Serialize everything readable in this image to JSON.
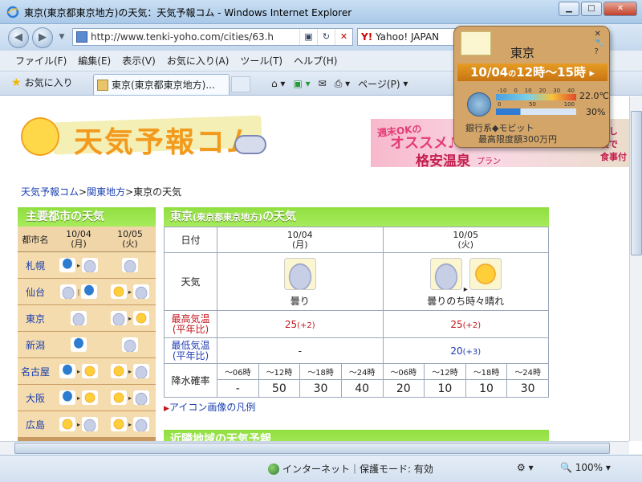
{
  "window": {
    "title": "東京(東京都東京地方)の天気：天気予報コム - Windows Internet Explorer"
  },
  "address": {
    "url": "http://www.tenki-yoho.com/cities/63.h",
    "search_label": "Yahoo! JAPAN"
  },
  "menu": [
    "ファイル(F)",
    "編集(E)",
    "表示(V)",
    "お気に入り(A)",
    "ツール(T)",
    "ヘルプ(H)"
  ],
  "tabbar": {
    "favorites_label": "お気に入り",
    "tab_title": "東京(東京都東京地方)...",
    "page_label": "ページ(P)"
  },
  "site": {
    "logo": "天気予報コム",
    "breadcrumb": [
      "天気予報コム",
      "関東地方",
      "東京の天気"
    ],
    "ad": {
      "line1": "週末OKの",
      "line2": "オススメ♪",
      "line3": "格安温泉",
      "line4": "プラン",
      "side1": "とし",
      "side2": "寝で",
      "side3": "食事付"
    }
  },
  "left_panel": {
    "title": "主要都市の天気",
    "col_city": "都市名",
    "col_d1": "10/04\n(月)",
    "col_d2": "10/05\n(火)",
    "rows": [
      {
        "city": "札幌"
      },
      {
        "city": "仙台"
      },
      {
        "city": "東京"
      },
      {
        "city": "新潟"
      },
      {
        "city": "名古屋"
      },
      {
        "city": "大阪"
      },
      {
        "city": "広島"
      }
    ]
  },
  "main": {
    "title": "東京",
    "title_sub": "(東京都東京地方)",
    "title_tail": "の天気",
    "label_date": "日付",
    "date1": "10/04\n(月)",
    "date2": "10/05\n(火)",
    "label_weather": "天気",
    "weather1": "曇り",
    "weather2": "曇りのち時々晴れ",
    "label_high": "最高気温\n(平年比)",
    "high1": "25",
    "high1_diff": "(+2)",
    "high2": "25",
    "high2_diff": "(+2)",
    "label_low": "最低気温\n(平年比)",
    "low1": "-",
    "low2": "20",
    "low2_diff": "(+3)",
    "label_rain": "降水確率",
    "rain_periods": [
      "〜06時",
      "〜12時",
      "〜18時",
      "〜24時",
      "〜06時",
      "〜12時",
      "〜18時",
      "〜24時"
    ],
    "rain_values": [
      "-",
      "50",
      "30",
      "40",
      "20",
      "10",
      "10",
      "30"
    ],
    "legend_link": "アイコン画像の凡例",
    "next_section": "近隣地域の天気予報"
  },
  "status": {
    "zone": "インターネット｜保護モード: 有効",
    "zoom": "100%"
  },
  "gadget": {
    "city": "東京",
    "date": "10/04",
    "mid": "の",
    "time": "12時〜15時",
    "temp_scale": [
      "-10",
      "0",
      "10",
      "20",
      "30",
      "40"
    ],
    "hum_scale": [
      "0",
      "50",
      "100"
    ],
    "temp": "22.0℃",
    "humidity": "30%",
    "ad_line1": "銀行系◆モビット",
    "ad_line2": "最高限度額300万円"
  }
}
